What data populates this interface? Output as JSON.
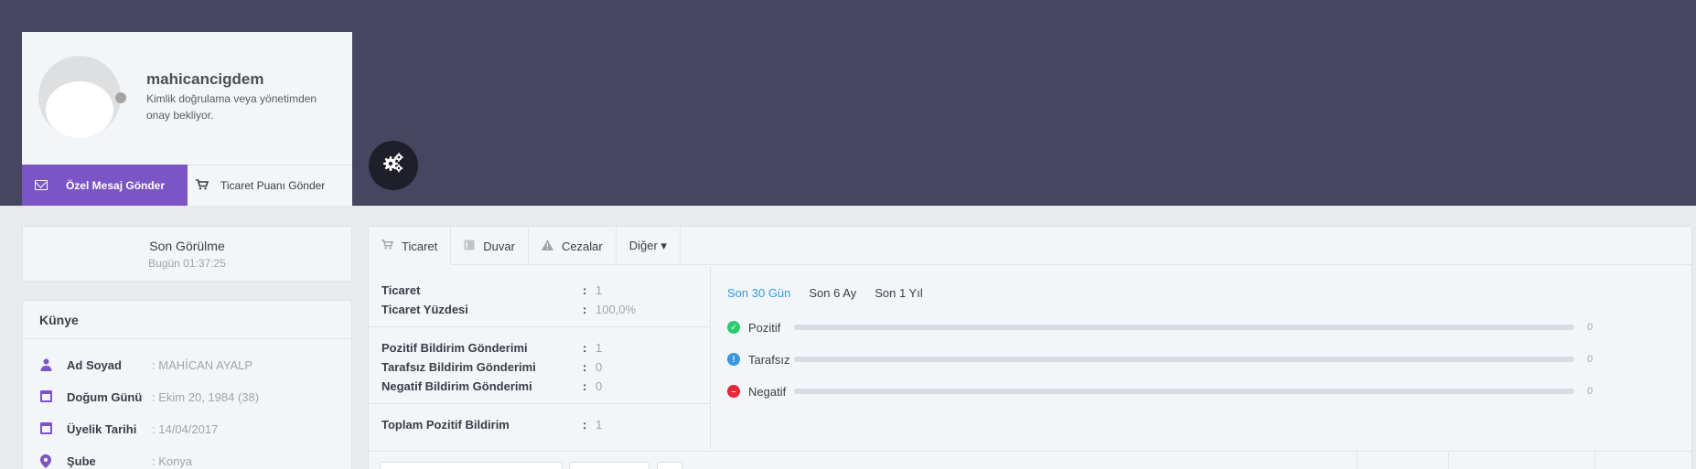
{
  "profile": {
    "username": "mahicancigdem",
    "verification_note": "Kimlik doğrulama veya yönetimden onay bekliyor.",
    "send_message_label": "Özel Mesaj Gönder",
    "send_trade_score_label": "Ticaret Puanı Gönder",
    "status_color": "#a5a5a5"
  },
  "last_seen": {
    "title": "Son Görülme",
    "value": "Bugün 01:37:25"
  },
  "kunye": {
    "title": "Künye",
    "rows": [
      {
        "icon": "user-icon",
        "label": "Ad Soyad",
        "sep": ":",
        "value": "MAHİCAN AYALP"
      },
      {
        "icon": "calendar-icon",
        "label": "Doğum Günü",
        "sep": ":",
        "value": "Ekim 20, 1984 (38)"
      },
      {
        "icon": "calendar-icon",
        "label": "Üyelik Tarihi",
        "sep": ":",
        "value": "14/04/2017"
      },
      {
        "icon": "location-pin-icon",
        "label": "Şube",
        "sep": ":",
        "value": "Konya"
      }
    ]
  },
  "tabs": [
    {
      "icon": "cart-icon",
      "label": "Ticaret"
    },
    {
      "icon": "book-icon",
      "label": "Duvar"
    },
    {
      "icon": "warning-icon",
      "label": "Cezalar"
    },
    {
      "icon": "",
      "label": "Diğer ▾"
    }
  ],
  "stats": {
    "rows": [
      {
        "key": "Ticaret",
        "sep": ":",
        "value": "1"
      },
      {
        "key": "Ticaret Yüzdesi",
        "sep": ":",
        "value": "100,0%"
      },
      {
        "key": "Pozitif Bildirim Gönderimi",
        "sep": ":",
        "value": "1"
      },
      {
        "key": "Tarafsız Bildirim Gönderimi",
        "sep": ":",
        "value": "0"
      },
      {
        "key": "Negatif Bildirim Gönderimi",
        "sep": ":",
        "value": "0"
      },
      {
        "key": "Toplam Pozitif Bildirim",
        "sep": ":",
        "value": "1"
      }
    ]
  },
  "ranges": [
    "Son 30 Gün",
    "Son 6 Ay",
    "Son 1 Yıl"
  ],
  "ratings": [
    {
      "label": "Pozitif",
      "count": "0",
      "fraction": 0,
      "color": "#2ecc71",
      "symbol": "✓",
      "icon": "check-circle-icon"
    },
    {
      "label": "Tarafsız",
      "count": "0",
      "fraction": 0,
      "color": "#3598dc",
      "symbol": "!",
      "icon": "info-circle-icon"
    },
    {
      "label": "Negatif",
      "count": "0",
      "fraction": 0,
      "color": "#e7263b",
      "symbol": "–",
      "icon": "minus-circle-icon"
    }
  ],
  "colors": {
    "accent": "#7b55c5",
    "hero": "#464660",
    "link": "#3598dc"
  }
}
